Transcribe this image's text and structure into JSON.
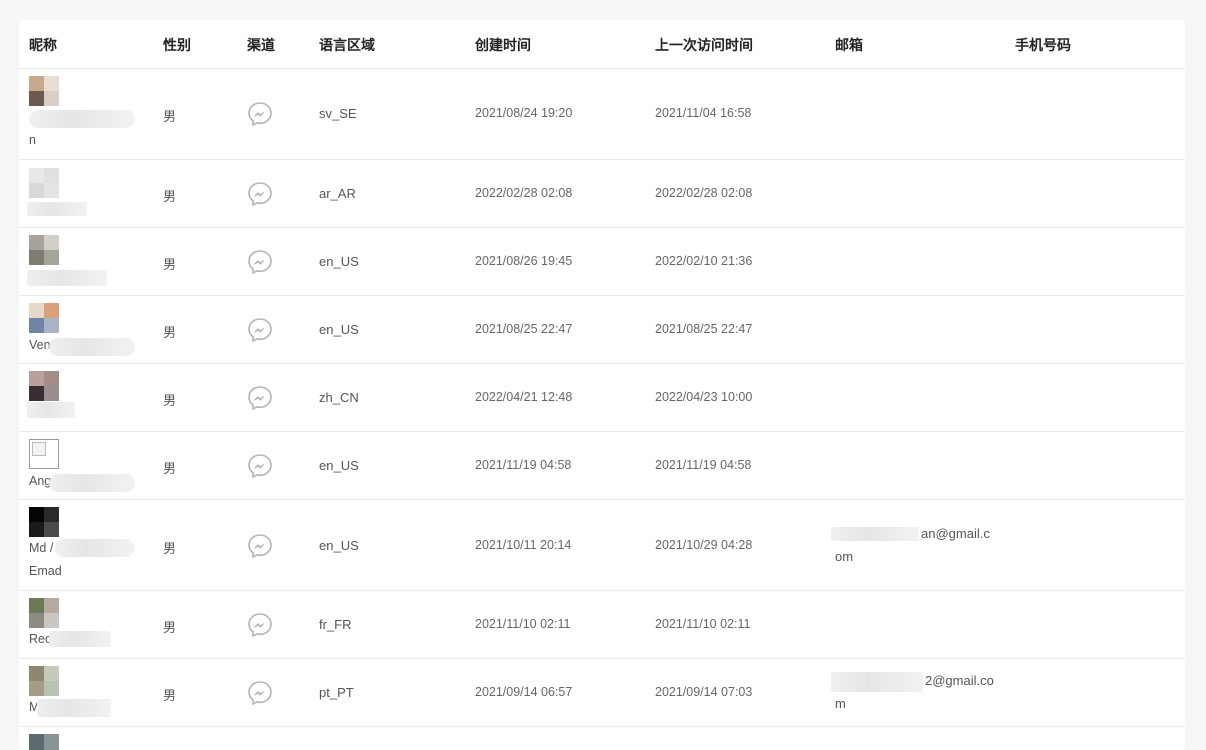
{
  "headers": {
    "nickname": "昵称",
    "gender": "性别",
    "channel": "渠道",
    "locale": "语言区域",
    "created": "创建时间",
    "last_visit": "上一次访问时间",
    "email": "邮箱",
    "phone": "手机号码"
  },
  "channel_icon": "messenger-icon",
  "rows": [
    {
      "name_a": "n",
      "name_b": "",
      "gender": "男",
      "locale": "sv_SE",
      "created": "2021/08/24 19:20",
      "last_visit": "2021/11/04 16:58",
      "email_a": "",
      "email_b": ""
    },
    {
      "name_a": "",
      "name_b": "",
      "gender": "男",
      "locale": "ar_AR",
      "created": "2022/02/28 02:08",
      "last_visit": "2022/02/28 02:08",
      "email_a": "",
      "email_b": ""
    },
    {
      "name_a": "",
      "name_b": "",
      "gender": "男",
      "locale": "en_US",
      "created": "2021/08/26 19:45",
      "last_visit": "2022/02/10 21:36",
      "email_a": "",
      "email_b": ""
    },
    {
      "name_a": "Ven",
      "name_b": "",
      "gender": "男",
      "locale": "en_US",
      "created": "2021/08/25 22:47",
      "last_visit": "2021/08/25 22:47",
      "email_a": "",
      "email_b": ""
    },
    {
      "name_a": "",
      "name_b": "",
      "gender": "男",
      "locale": "zh_CN",
      "created": "2022/04/21 12:48",
      "last_visit": "2022/04/23 10:00",
      "email_a": "",
      "email_b": ""
    },
    {
      "name_a": "Ang",
      "name_b": "",
      "gender": "男",
      "locale": "en_US",
      "created": "2021/11/19 04:58",
      "last_visit": "2021/11/19 04:58",
      "email_a": "",
      "email_b": ""
    },
    {
      "name_a": "Md /",
      "name_b": "Emad",
      "gender": "男",
      "locale": "en_US",
      "created": "2021/10/11 20:14",
      "last_visit": "2021/10/29 04:28",
      "email_a": "an@gmail.c",
      "email_b": "om"
    },
    {
      "name_a": "Rec",
      "name_b": "",
      "gender": "男",
      "locale": "fr_FR",
      "created": "2021/11/10 02:11",
      "last_visit": "2021/11/10 02:11",
      "email_a": "",
      "email_b": ""
    },
    {
      "name_a": "M",
      "name_b": "",
      "gender": "男",
      "locale": "pt_PT",
      "created": "2021/09/14 06:57",
      "last_visit": "2021/09/14 07:03",
      "email_a": "2@gmail.co",
      "email_b": "m"
    }
  ]
}
